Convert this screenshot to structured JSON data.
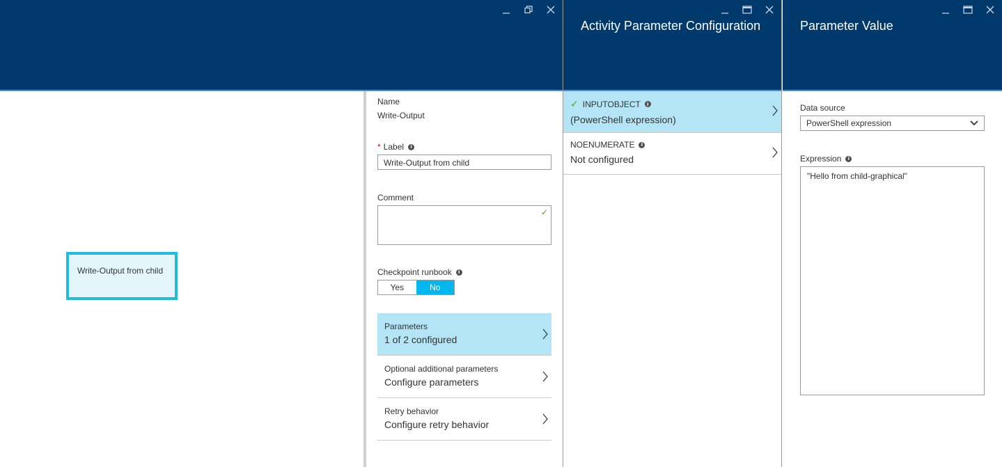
{
  "blade1": {
    "designer": {
      "activity_label": "Write-Output from child"
    },
    "props": {
      "name_label": "Name",
      "name_value": "Write-Output",
      "label_required": "*",
      "label_label": "Label",
      "label_value": "Write-Output from child",
      "comment_label": "Comment",
      "comment_value": "",
      "checkpoint_label": "Checkpoint runbook",
      "toggle_yes": "Yes",
      "toggle_no": "No",
      "toggle_selected": "No"
    },
    "nav": [
      {
        "title": "Parameters",
        "value": "1 of 2 configured"
      },
      {
        "title": "Optional additional parameters",
        "value": "Configure parameters"
      },
      {
        "title": "Retry behavior",
        "value": "Configure retry behavior"
      }
    ]
  },
  "blade2": {
    "title": "Activity Parameter Configuration",
    "params": [
      {
        "name": "INPUTOBJECT",
        "value": "(PowerShell expression)"
      },
      {
        "name": "NOENUMERATE",
        "value": "Not configured"
      }
    ]
  },
  "blade3": {
    "title": "Parameter Value",
    "data_source_label": "Data source",
    "data_source_value": "PowerShell expression",
    "expression_label": "Expression",
    "expression_value": "\"Hello from child-graphical\""
  },
  "icons": {
    "minimize": "minimize-icon",
    "restore": "restore-icon",
    "maximize": "maximize-icon",
    "close": "close-icon",
    "info": "info-icon",
    "chevron": "chevron-right-icon",
    "check": "checkmark-icon"
  },
  "colors": {
    "header_bg": "#003a6c",
    "selected_bg": "#b3e5f6",
    "accent": "#00b7ef",
    "activity_border": "#1fbbe0",
    "success": "#5aa50c"
  }
}
